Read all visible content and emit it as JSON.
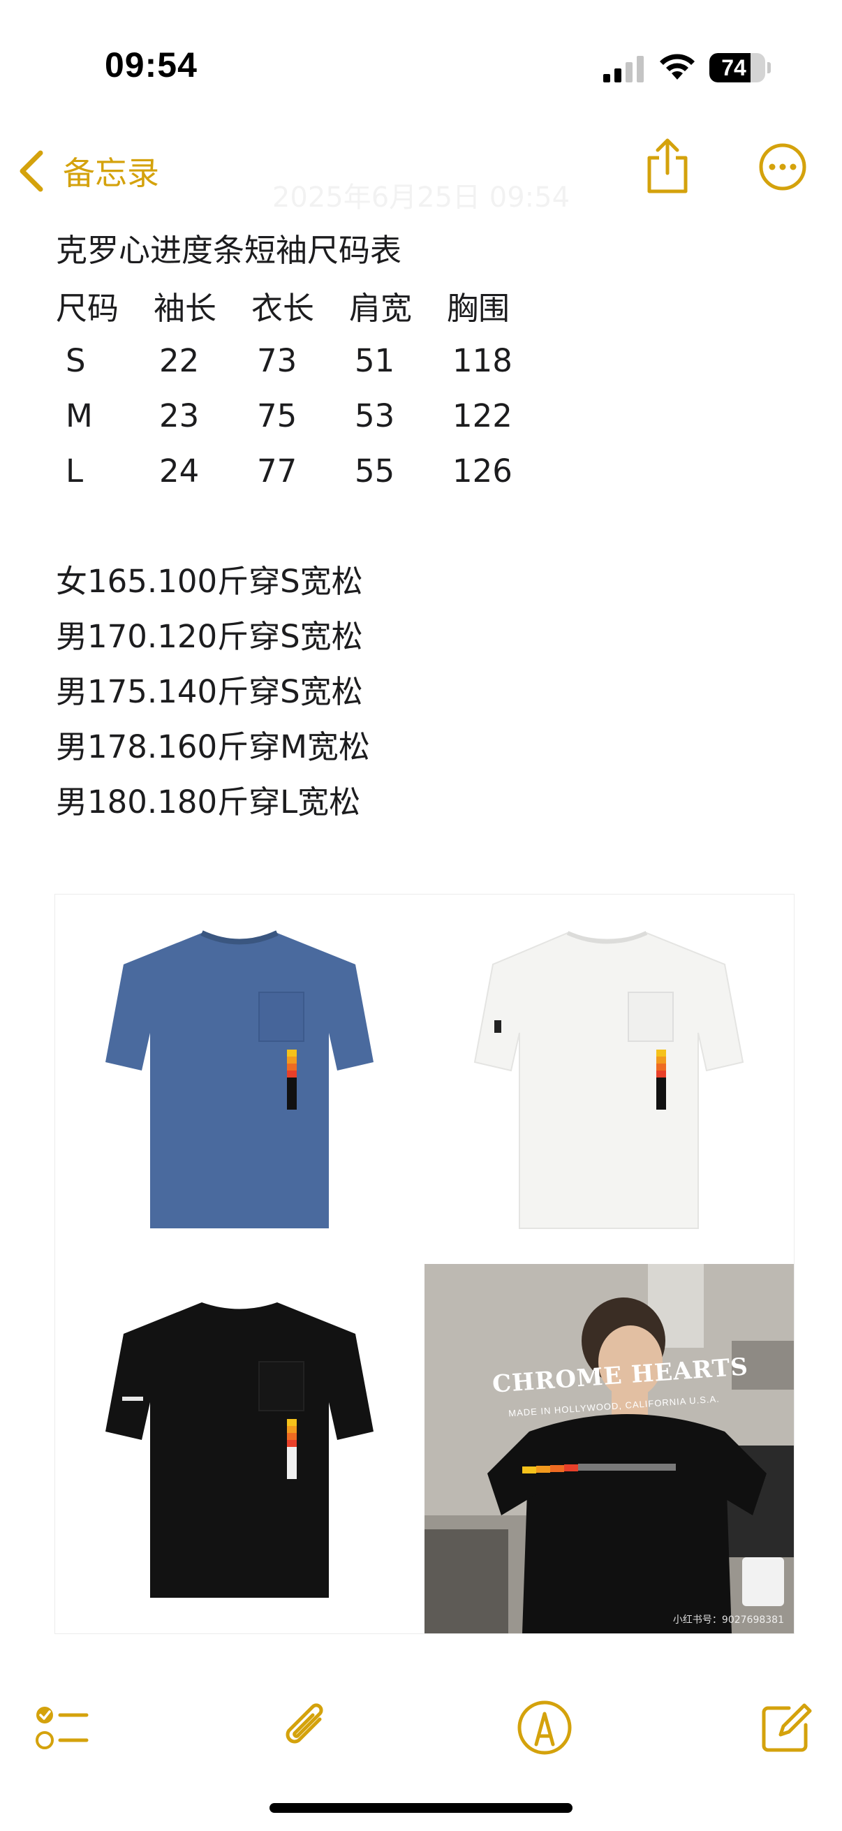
{
  "status_bar": {
    "time": "09:54",
    "battery": "74",
    "battery_level": 0.74,
    "signal_bars_active": 2,
    "signal_bars_total": 4
  },
  "nav": {
    "back_label": "备忘录",
    "faded_date": "2025年6月25日 09:54",
    "accent_color": "#d4a20c"
  },
  "note": {
    "title": "克罗心进度条短袖尺码表",
    "table": {
      "headers": [
        "尺码",
        "袖长",
        "衣长",
        "肩宽",
        "胸围"
      ],
      "rows": [
        [
          "S",
          "22",
          "73",
          "51",
          "118"
        ],
        [
          "M",
          "23",
          "75",
          "53",
          "122"
        ],
        [
          "L",
          "24",
          "77",
          "55",
          "126"
        ]
      ]
    },
    "fit_lines": [
      "女165.100斤穿S宽松",
      "男170.120斤穿S宽松",
      "男175.140斤穿S宽松",
      "男178.160斤穿M宽松",
      "男180.180斤穿L宽松"
    ]
  },
  "images": {
    "photo_caption": "CHROME HEARTS",
    "photo_subcaption": "MADE IN HOLLYWOOD, CALIFORNIA U.S.A.",
    "watermark": "小红书号：9027698381",
    "shirt_colors": {
      "blue": "#4a6a9e",
      "white": "#f4f4f2",
      "black": "#121212"
    }
  },
  "toolbar": {
    "icons": [
      "checklist-icon",
      "paperclip-icon",
      "markup-pen-icon",
      "compose-icon"
    ]
  }
}
